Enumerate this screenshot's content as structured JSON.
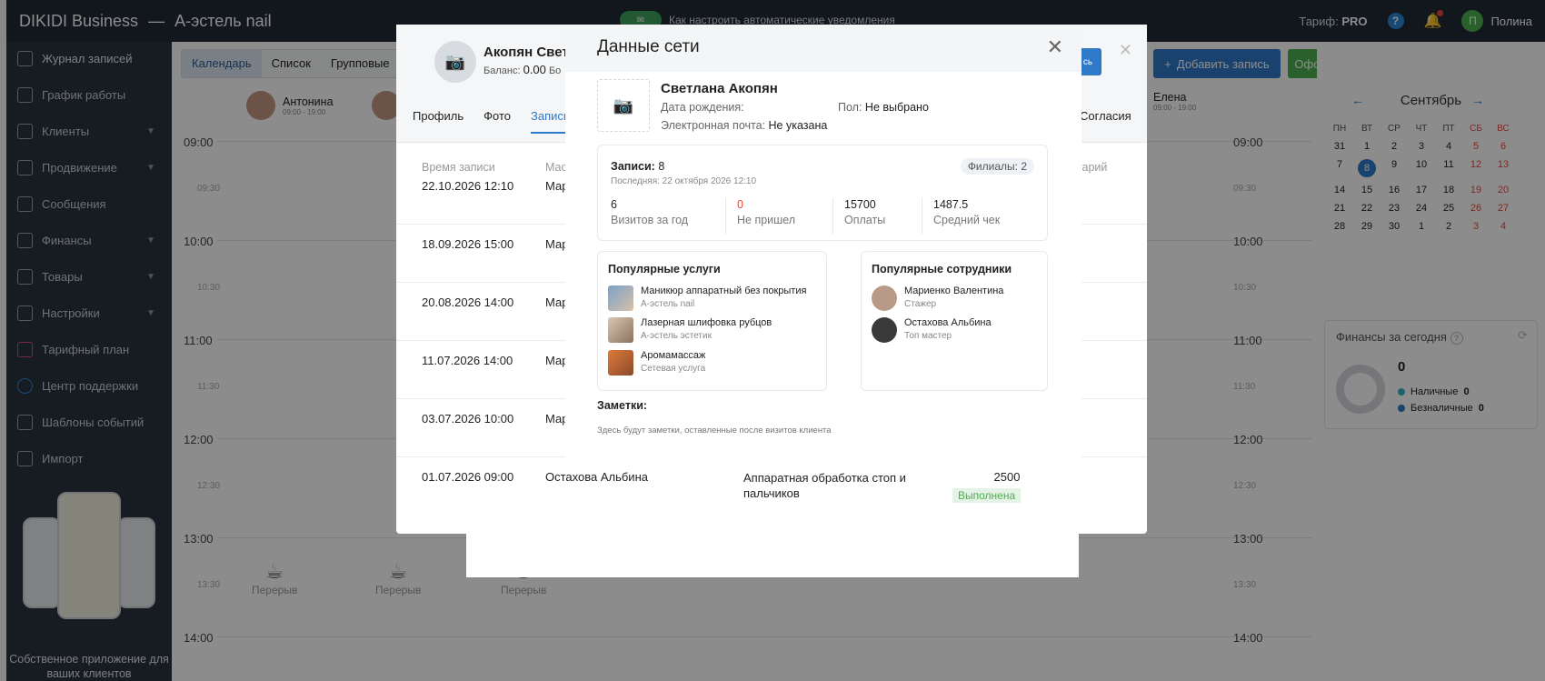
{
  "app": {
    "title": "DIKIDI Business",
    "separator": "—",
    "company": "А-эстель nail",
    "promo_text": "Как настроить автоматические уведомления",
    "tariff_label": "Тариф:",
    "tariff_value": "PRO",
    "help": "?",
    "user_initial": "П",
    "user_name": "Полина"
  },
  "sidebar": {
    "items": [
      {
        "label": "Журнал записей"
      },
      {
        "label": "График работы"
      },
      {
        "label": "Клиенты"
      },
      {
        "label": "Продвижение"
      },
      {
        "label": "Сообщения"
      },
      {
        "label": "Финансы"
      },
      {
        "label": "Товары"
      },
      {
        "label": "Настройки"
      },
      {
        "label": "Тарифный план"
      },
      {
        "label": "Центр поддержки"
      },
      {
        "label": "Шаблоны событий"
      },
      {
        "label": "Импорт"
      }
    ],
    "promo": "Собственное приложение для ваших клиентов"
  },
  "toolbar": {
    "views": [
      "Календарь",
      "Список",
      "Групповые"
    ],
    "add_label": "Добавить запись",
    "sale_label": "Оформить продажу"
  },
  "calendar_grid": {
    "staff": [
      {
        "name": "Антонина",
        "hours": "09:00 - 19:00"
      },
      {
        "name": "Елена",
        "hours": "09:00 - 19:00"
      }
    ],
    "times": [
      "09:00",
      "09:30",
      "10:00",
      "10:30",
      "11:00",
      "11:30",
      "12:00",
      "12:30",
      "13:00",
      "13:30",
      "14:00"
    ],
    "break_label": "Перерыв"
  },
  "mini_calendar": {
    "month": "Сентябрь",
    "weekdays": [
      "ПН",
      "ВТ",
      "СР",
      "ЧТ",
      "ПТ",
      "СБ",
      "ВС"
    ],
    "days": [
      "31",
      "1",
      "2",
      "3",
      "4",
      "5",
      "6",
      "7",
      "8",
      "9",
      "10",
      "11",
      "12",
      "13",
      "14",
      "15",
      "16",
      "17",
      "18",
      "19",
      "20",
      "21",
      "22",
      "23",
      "24",
      "25",
      "26",
      "27",
      "28",
      "29",
      "30",
      "1",
      "2",
      "3",
      "4"
    ],
    "today": "8"
  },
  "finance": {
    "title": "Финансы за сегодня",
    "total": "0",
    "cash_label": "Наличные",
    "cash_value": "0",
    "card_label": "Безналичные",
    "card_value": "0"
  },
  "client_card": {
    "name": "Акопян Свет",
    "balance_label": "Баланс:",
    "balance_value": "0.00",
    "balance_suffix": "Бо",
    "tabs": [
      "Профиль",
      "Фото",
      "Записи"
    ],
    "tab_right": "Согласия",
    "blue_btn": "сь",
    "headers": {
      "time": "Время записи",
      "staff": "Мас",
      "comment": "нтарий"
    },
    "records": [
      {
        "date": "22.10.2026 12:10",
        "staff": "Мар",
        "service": "",
        "price": "",
        "status": ""
      },
      {
        "date": "18.09.2026 15:00",
        "staff": "Мар",
        "service": "",
        "price": "",
        "status": ""
      },
      {
        "date": "20.08.2026 14:00",
        "staff": "Мар",
        "service": "",
        "price": "",
        "status": ""
      },
      {
        "date": "11.07.2026 14:00",
        "staff": "Мар",
        "service": "",
        "price": "",
        "status": ""
      },
      {
        "date": "03.07.2026 10:00",
        "staff": "Мар",
        "service": "",
        "price": "",
        "status": ""
      },
      {
        "date": "01.07.2026 09:00",
        "staff": "Остахова Альбина",
        "service": "Аппаратная обработка стоп и пальчиков",
        "price": "2500",
        "status": "Выполнена"
      }
    ]
  },
  "modal": {
    "title": "Данные сети",
    "client_name": "Светлана Акопян",
    "birth_label": "Дата рождения:",
    "birth_value": "",
    "gender_label": "Пол:",
    "gender_value": "Не выбрано",
    "email_label": "Электронная почта:",
    "email_value": "Не указана",
    "records_label": "Записи:",
    "records_value": "8",
    "last_label": "Последняя: 22 октября 2026 12:10",
    "branches": "Филиалы: 2",
    "stats": [
      {
        "value": "6",
        "label": "Визитов за год"
      },
      {
        "value": "0",
        "label": "Не пришел"
      },
      {
        "value": "15700",
        "label": "Оплаты"
      },
      {
        "value": "1487.5",
        "label": "Средний чек"
      }
    ],
    "popular_services_title": "Популярные услуги",
    "popular_services": [
      {
        "name": "Маникюр аппаратный без покрытия",
        "place": "А-эстель nail"
      },
      {
        "name": "Лазерная шлифовка рубцов",
        "place": "А-эстель эстетик"
      },
      {
        "name": "Аромамассаж",
        "place": "Сетевая услуга"
      }
    ],
    "popular_staff_title": "Популярные сотрудники",
    "popular_staff": [
      {
        "name": "Мариенко Валентина",
        "role": "Стажер"
      },
      {
        "name": "Остахова Альбина",
        "role": "Топ мастер"
      }
    ],
    "notes_title": "Заметки:",
    "notes_text": "Здесь будут заметки, оставленные после визитов клиента"
  },
  "colors": {
    "accent": "#2f79c9",
    "success": "#4caf50",
    "danger": "#e9483b",
    "sidebar": "#2a3441",
    "topbar": "#222b36"
  }
}
